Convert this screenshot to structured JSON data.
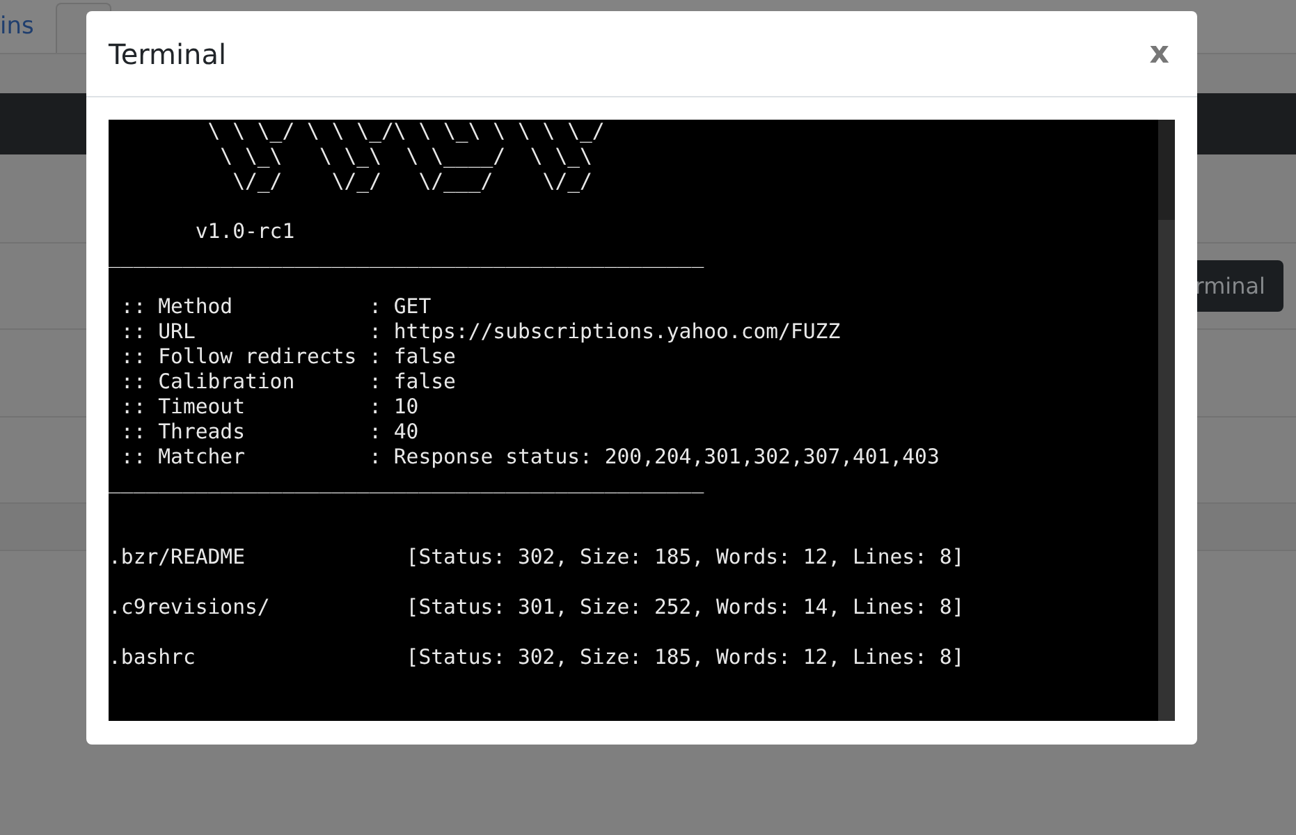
{
  "background": {
    "tabs": [
      {
        "label": "ins",
        "selected": false
      },
      {
        "selected": true
      }
    ],
    "terminal_button": "rminal"
  },
  "modal": {
    "title": "Terminal",
    "close": "x",
    "terminal": {
      "lines": [
        {
          "kind": "text",
          "text": "        \\ \\ \\_/ \\ \\ \\_/\\ \\ \\_\\ \\ \\ \\ \\_/"
        },
        {
          "kind": "text",
          "text": "         \\ \\_\\   \\ \\_\\  \\ \\____/  \\ \\_\\"
        },
        {
          "kind": "text",
          "text": "          \\/_/    \\/_/   \\/___/    \\/_/"
        },
        {
          "kind": "blank"
        },
        {
          "kind": "text",
          "text": "       v1.0-rc1"
        },
        {
          "kind": "text",
          "text": "________________________________________________"
        },
        {
          "kind": "blank"
        },
        {
          "kind": "text",
          "text": " :: Method           : GET"
        },
        {
          "kind": "text",
          "text": " :: URL              : https://subscriptions.yahoo.com/FUZZ"
        },
        {
          "kind": "text",
          "text": " :: Follow redirects : false"
        },
        {
          "kind": "text",
          "text": " :: Calibration      : false"
        },
        {
          "kind": "text",
          "text": " :: Timeout          : 10"
        },
        {
          "kind": "text",
          "text": " :: Threads          : 40"
        },
        {
          "kind": "text",
          "text": " :: Matcher          : Response status: 200,204,301,302,307,401,403"
        },
        {
          "kind": "text",
          "text": "________________________________________________"
        },
        {
          "kind": "blank"
        },
        {
          "kind": "blank"
        },
        {
          "kind": "text",
          "text": ".bzr/README             [Status: 302, Size: 185, Words: 12, Lines: 8]"
        },
        {
          "kind": "blank"
        },
        {
          "kind": "text",
          "text": ".c9revisions/           [Status: 301, Size: 252, Words: 14, Lines: 8]"
        },
        {
          "kind": "blank"
        },
        {
          "kind": "text",
          "text": ".bashrc                 [Status: 302, Size: 185, Words: 12, Lines: 8]"
        }
      ]
    }
  }
}
